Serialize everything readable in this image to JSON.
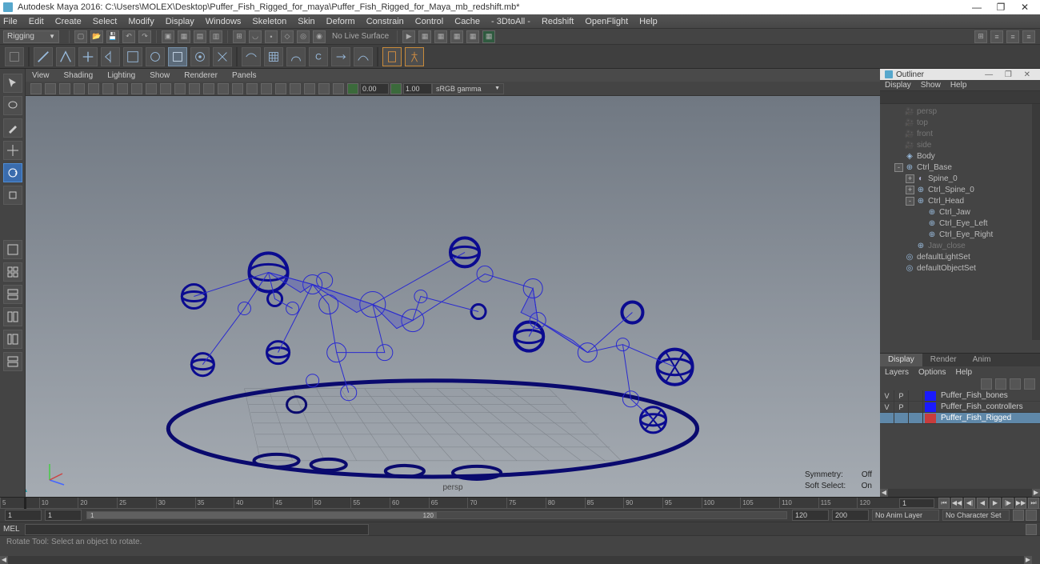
{
  "title": "Autodesk Maya 2016: C:\\Users\\MOLEX\\Desktop\\Puffer_Fish_Rigged_for_maya\\Puffer_Fish_Rigged_for_Maya_mb_redshift.mb*",
  "menu": [
    "File",
    "Edit",
    "Create",
    "Select",
    "Modify",
    "Display",
    "Windows",
    "Skeleton",
    "Skin",
    "Deform",
    "Constrain",
    "Control",
    "Cache",
    "- 3DtoAll -",
    "Redshift",
    "OpenFlight",
    "Help"
  ],
  "shelf_mode": "Rigging",
  "no_live": "No Live Surface",
  "vp_menu": [
    "View",
    "Shading",
    "Lighting",
    "Show",
    "Renderer",
    "Panels"
  ],
  "exposure": "0.00",
  "gamma": "1.00",
  "colorspace": "sRGB gamma",
  "persp": "persp",
  "hud": {
    "symmetry_label": "Symmetry:",
    "symmetry": "Off",
    "softsel_label": "Soft Select:",
    "softsel": "On"
  },
  "outliner": {
    "title": "Outliner",
    "menu": [
      "Display",
      "Show",
      "Help"
    ],
    "items": [
      {
        "depth": 0,
        "name": "persp",
        "type": "camera",
        "dim": true,
        "exp": ""
      },
      {
        "depth": 0,
        "name": "top",
        "type": "camera",
        "dim": true,
        "exp": ""
      },
      {
        "depth": 0,
        "name": "front",
        "type": "camera",
        "dim": true,
        "exp": ""
      },
      {
        "depth": 0,
        "name": "side",
        "type": "camera",
        "dim": true,
        "exp": ""
      },
      {
        "depth": 0,
        "name": "Body",
        "type": "mesh",
        "exp": ""
      },
      {
        "depth": 0,
        "name": "Ctrl_Base",
        "type": "ctrl",
        "exp": "-"
      },
      {
        "depth": 1,
        "name": "Spine_0",
        "type": "joint",
        "exp": "+"
      },
      {
        "depth": 1,
        "name": "Ctrl_Spine_0",
        "type": "ctrl",
        "exp": "+"
      },
      {
        "depth": 1,
        "name": "Ctrl_Head",
        "type": "ctrl",
        "exp": "-"
      },
      {
        "depth": 2,
        "name": "Ctrl_Jaw",
        "type": "ctrl",
        "exp": ""
      },
      {
        "depth": 2,
        "name": "Ctrl_Eye_Left",
        "type": "ctrl",
        "exp": ""
      },
      {
        "depth": 2,
        "name": "Ctrl_Eye_Right",
        "type": "ctrl",
        "exp": ""
      },
      {
        "depth": 1,
        "name": "Jaw_close",
        "type": "ctrl",
        "dim": true,
        "exp": ""
      },
      {
        "depth": 0,
        "name": "defaultLightSet",
        "type": "set",
        "exp": ""
      },
      {
        "depth": 0,
        "name": "defaultObjectSet",
        "type": "set",
        "exp": ""
      }
    ]
  },
  "layer_panel": {
    "tabs": [
      "Display",
      "Render",
      "Anim"
    ],
    "menu": [
      "Layers",
      "Options",
      "Help"
    ],
    "layers": [
      {
        "v": "V",
        "p": "P",
        "color": "#1a1aff",
        "name": "Puffer_Fish_bones",
        "sel": false
      },
      {
        "v": "V",
        "p": "P",
        "color": "#1a1aff",
        "name": "Puffer_Fish_controllers",
        "sel": false
      },
      {
        "v": "",
        "p": "",
        "color": "#c83c3c",
        "name": "Puffer_Fish_Rigged",
        "sel": true
      }
    ]
  },
  "time": {
    "ticks": [
      "5",
      "10",
      "20",
      "25",
      "30",
      "35",
      "40",
      "45",
      "50",
      "55",
      "60",
      "65",
      "70",
      "75",
      "80",
      "85",
      "90",
      "95",
      "100",
      "105",
      "110",
      "115",
      "120"
    ],
    "range_start_outer": "1",
    "range_start": "1",
    "range_label": "1",
    "range_end": "120",
    "range_end_outer": "120",
    "end2": "200",
    "anim_layer": "No Anim Layer",
    "char_set": "No Character Set"
  },
  "cmd_label": "MEL",
  "status": "Rotate Tool: Select an object to rotate."
}
